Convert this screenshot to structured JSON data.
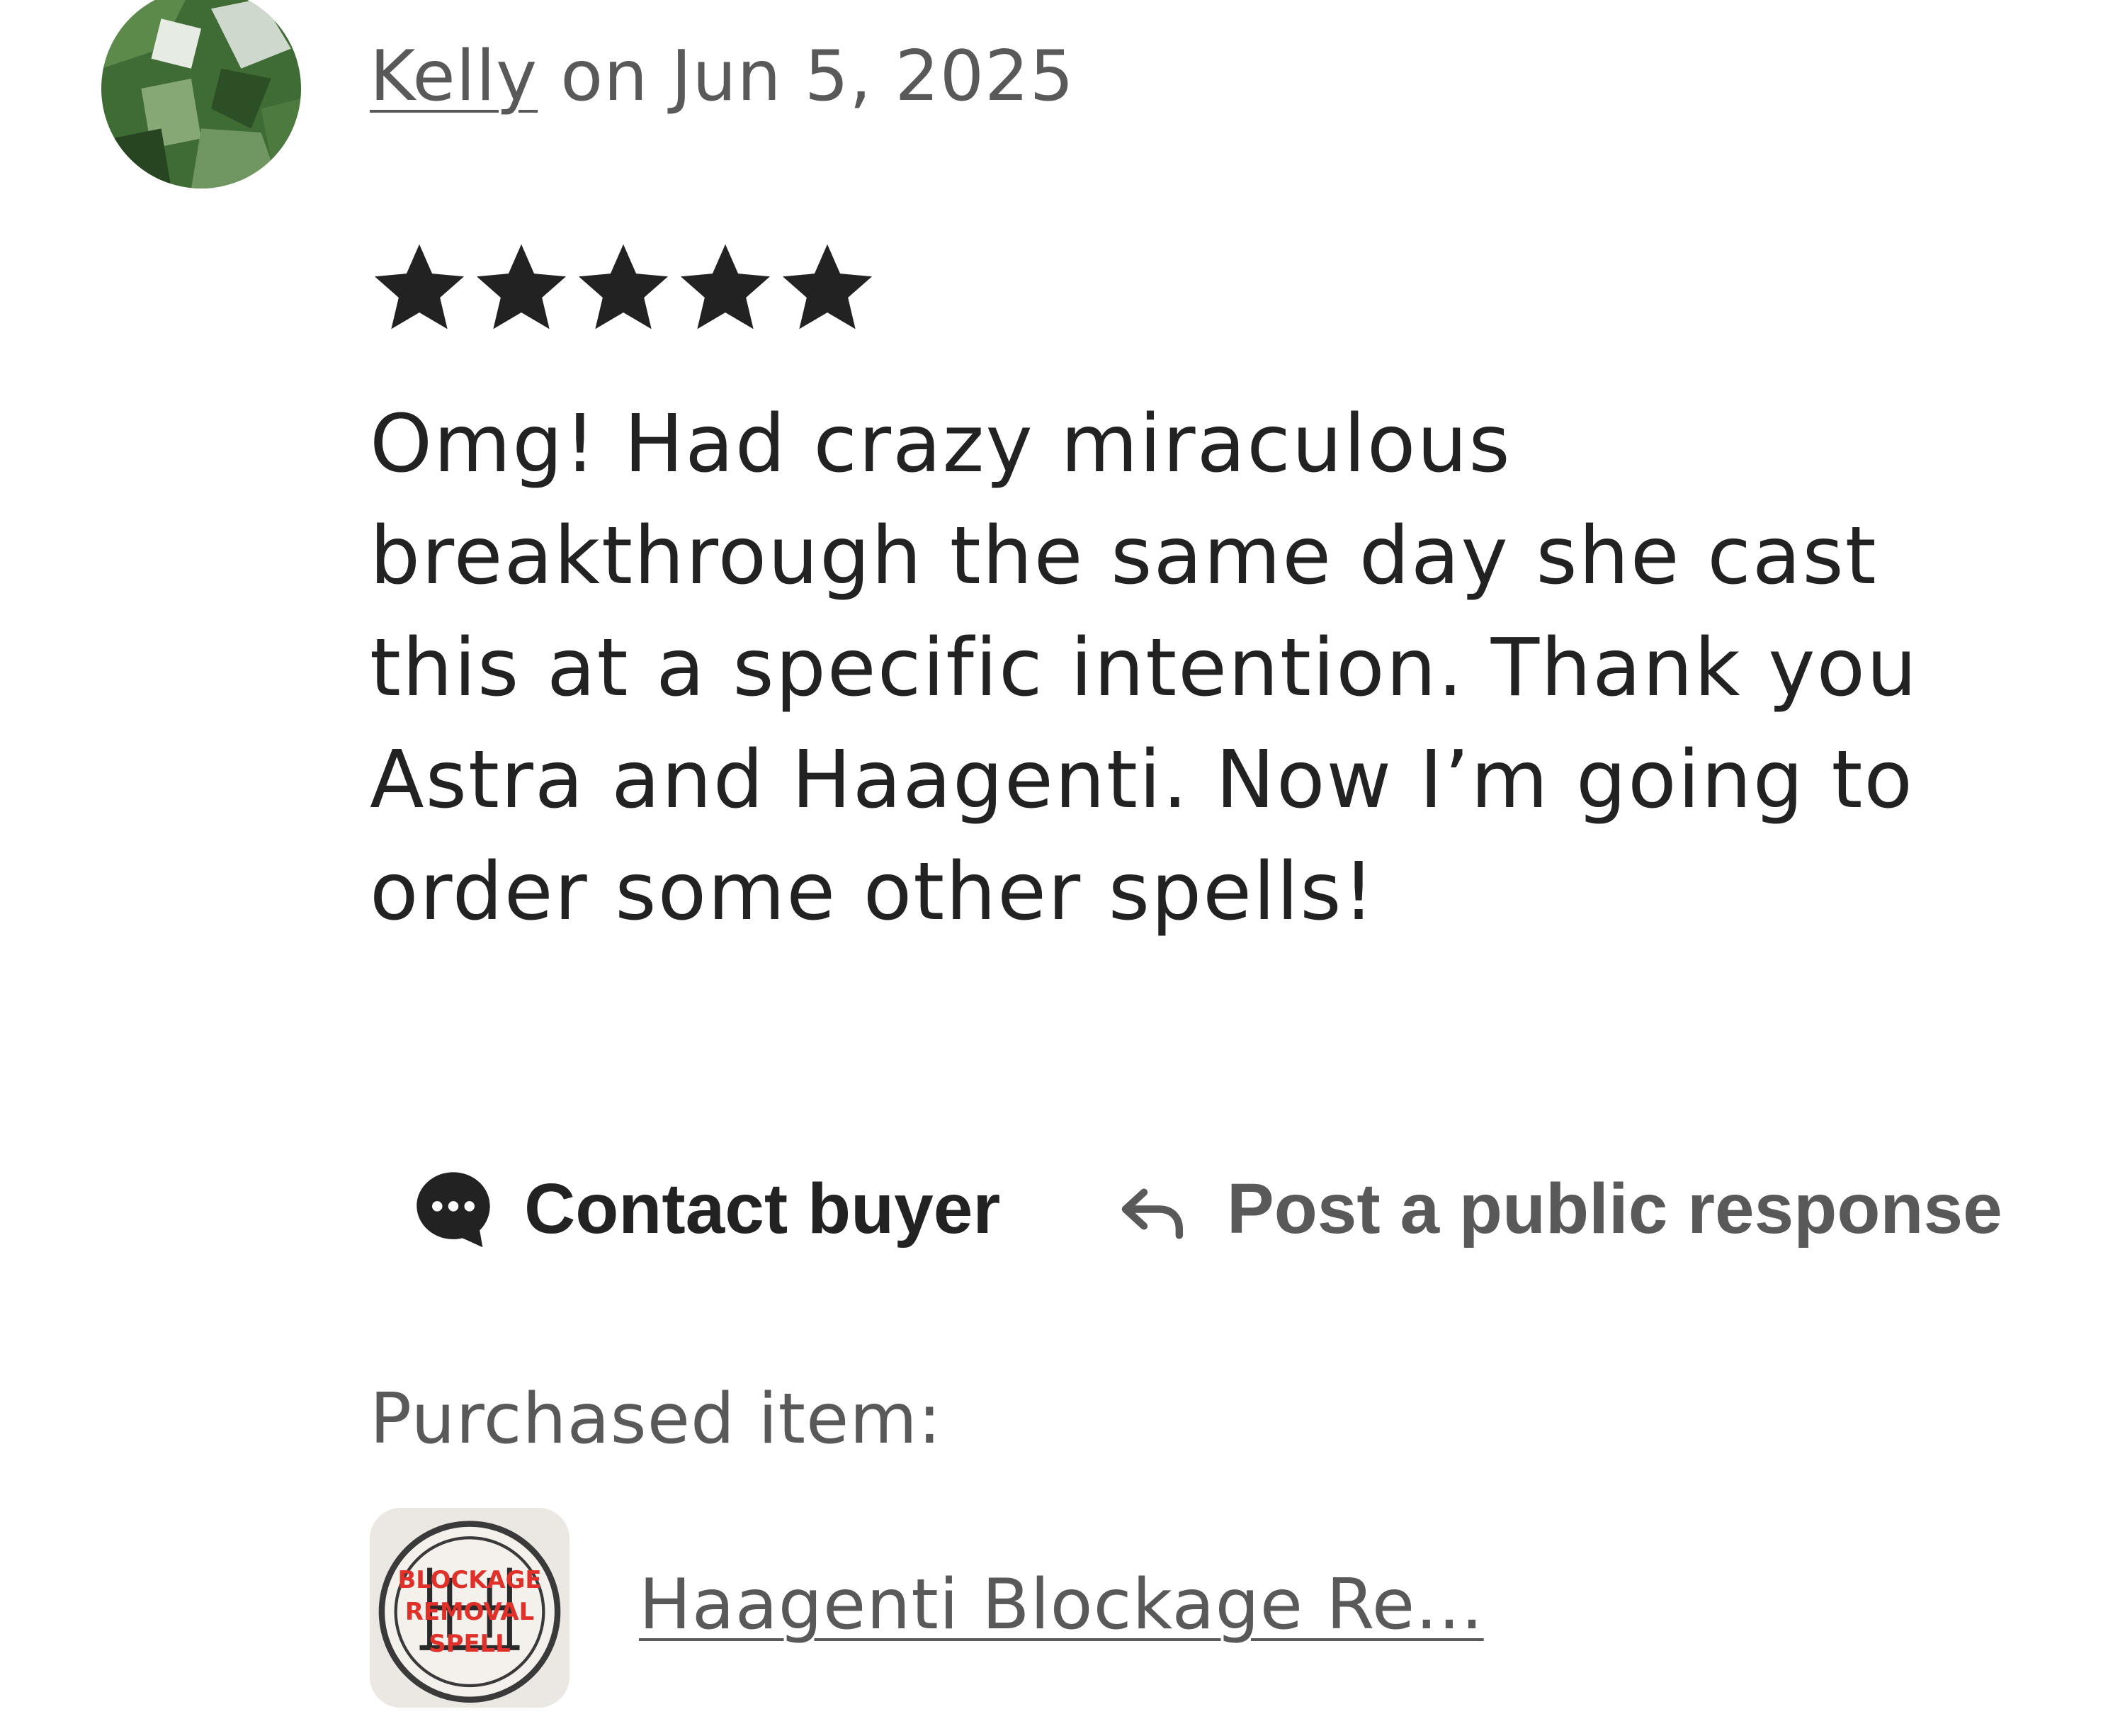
{
  "review": {
    "reviewer_name": "Kelly",
    "date_text": " on Jun 5, 2025",
    "rating": 5,
    "rating_max": 5,
    "text_lines": [
      "Omg! Had crazy miraculous",
      "breakthrough the same day she cast",
      "this at a specific intention. Thank you",
      "Astra and Haagenti. Now I’m going to",
      "order some other spells!"
    ]
  },
  "actions": {
    "contact_label": "Contact buyer",
    "contact_icon": "chat-bubble-icon",
    "respond_label": "Post a public response",
    "respond_icon": "reply-arrow-icon"
  },
  "purchase": {
    "label": "Purchased item:",
    "item_name": "Haagenti Blockage Re...",
    "thumbnail_text": [
      "BLOCKAGE",
      "REMOVAL",
      "SPELL"
    ]
  },
  "colors": {
    "text_primary": "#222222",
    "text_secondary": "#595959",
    "star": "#222222",
    "thumbnail_text": "#e0302a"
  }
}
